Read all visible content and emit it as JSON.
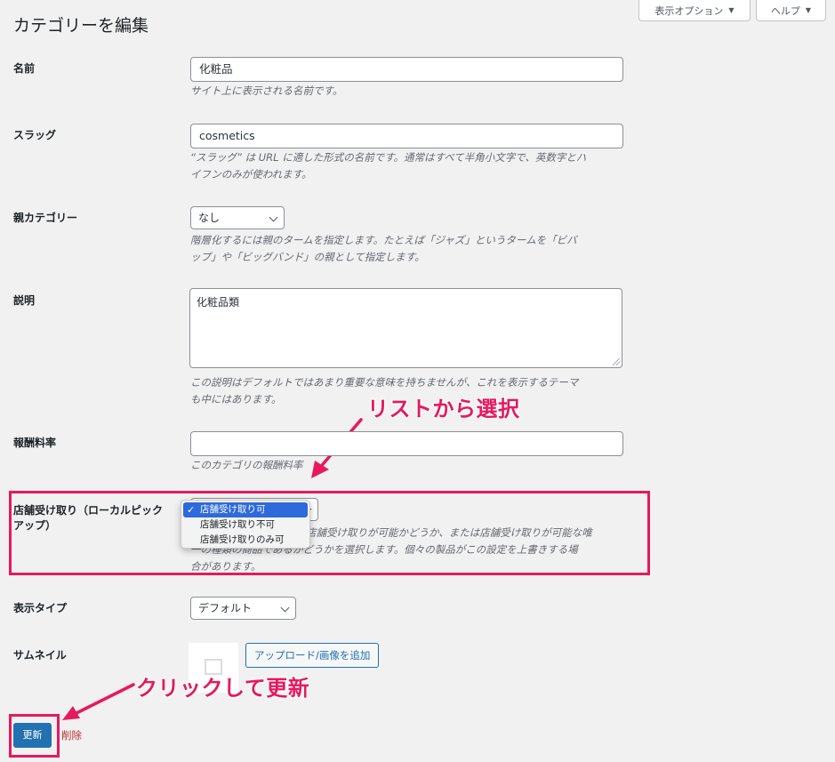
{
  "page_title": "カテゴリーを編集",
  "top_buttons": {
    "screen_options": "表示オプション",
    "help": "ヘルプ"
  },
  "fields": {
    "name": {
      "label": "名前",
      "value": "化粧品",
      "description": "サイト上に表示される名前です。"
    },
    "slug": {
      "label": "スラッグ",
      "value": "cosmetics",
      "description_line1": "“スラッグ” は URL に適した形式の名前です。通常はすべて半角小文字で、英数字とハ",
      "description_line2": "イフンのみが使われます。"
    },
    "parent": {
      "label": "親カテゴリー",
      "selected": "なし",
      "description_line1": "階層化するには親のタームを指定します。たとえば「ジャズ」というタームを「ビバ",
      "description_line2": "ップ」や「ビッグバンド」の親として指定します。"
    },
    "description": {
      "label": "説明",
      "value": "化粧品類",
      "description_line1": "この説明はデフォルトではあまり重要な意味を持ちませんが、これを表示するテーマ",
      "description_line2": "も中にはあります。"
    },
    "commission": {
      "label": "報酬料率",
      "value": "",
      "description": "このカテゴリの報酬料率"
    },
    "pickup": {
      "label_line1": "店舗受け取り（ローカルピック",
      "label_line2": "アップ）",
      "options": [
        "店舗受け取り可",
        "店舗受け取り不可",
        "店舗受け取りのみ可"
      ],
      "selected_index": 0,
      "description_line1": "店舗受け取りが可能かどうか、または店舗受け取りが可能な唯",
      "description_line2": "一の種類の商品であるかどうかを選択します。個々の製品がこの設定を上書きする場",
      "description_line3": "合があります。"
    },
    "display_type": {
      "label": "表示タイプ",
      "selected": "デフォルト"
    },
    "thumbnail": {
      "label": "サムネイル",
      "upload_button": "アップロード/画像を追加"
    }
  },
  "actions": {
    "update": "更新",
    "delete": "削除"
  },
  "annotations": {
    "select_from_list": "リストから選択",
    "click_to_update": "クリックして更新"
  },
  "colors": {
    "accent": "#e6195f",
    "primary_button": "#2271b1",
    "delete_link": "#b32d2e",
    "dropdown_selected": "#2e6ad9"
  }
}
